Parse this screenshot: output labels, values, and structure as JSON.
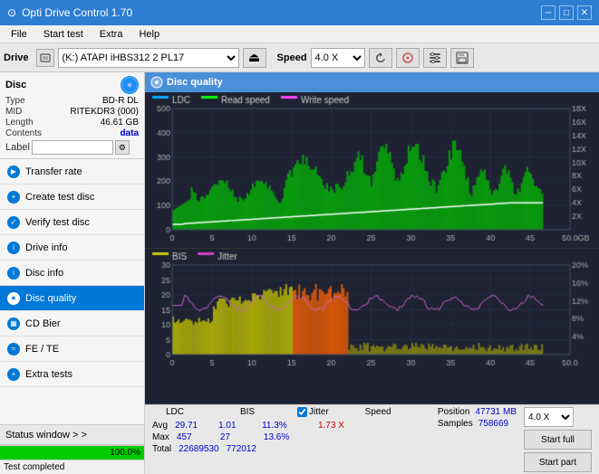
{
  "app": {
    "title": "Opti Drive Control 1.70",
    "icon": "⊙"
  },
  "titlebar": {
    "minimize": "─",
    "maximize": "□",
    "close": "✕"
  },
  "menu": {
    "items": [
      "File",
      "Start test",
      "Extra",
      "Help"
    ]
  },
  "drive_bar": {
    "label": "Drive",
    "drive_value": "(K:) ATAPI iHBS312  2 PL17",
    "speed_label": "Speed",
    "speed_value": "4.0 X"
  },
  "disc": {
    "title": "Disc",
    "type_label": "Type",
    "type_value": "BD-R DL",
    "mid_label": "MID",
    "mid_value": "RITEKDR3 (000)",
    "length_label": "Length",
    "length_value": "46.61 GB",
    "contents_label": "Contents",
    "contents_value": "data",
    "label_label": "Label",
    "label_value": ""
  },
  "nav": {
    "items": [
      {
        "id": "transfer-rate",
        "label": "Transfer rate",
        "active": false
      },
      {
        "id": "create-test-disc",
        "label": "Create test disc",
        "active": false
      },
      {
        "id": "verify-test-disc",
        "label": "Verify test disc",
        "active": false
      },
      {
        "id": "drive-info",
        "label": "Drive info",
        "active": false
      },
      {
        "id": "disc-info",
        "label": "Disc info",
        "active": false
      },
      {
        "id": "disc-quality",
        "label": "Disc quality",
        "active": true
      },
      {
        "id": "cd-bier",
        "label": "CD Bier",
        "active": false
      },
      {
        "id": "fe-te",
        "label": "FE / TE",
        "active": false
      },
      {
        "id": "extra-tests",
        "label": "Extra tests",
        "active": false
      }
    ]
  },
  "disc_quality": {
    "title": "Disc quality",
    "legend_ldc": "LDC",
    "legend_read": "Read speed",
    "legend_write": "Write speed",
    "legend_bis": "BIS",
    "legend_jitter": "Jitter",
    "x_max": "50.0",
    "x_label": "GB"
  },
  "stats": {
    "headers": [
      "LDC",
      "BIS",
      "",
      "Jitter",
      "Speed",
      ""
    ],
    "avg_label": "Avg",
    "avg_ldc": "29.71",
    "avg_bis": "1.01",
    "avg_jitter": "11.3%",
    "max_label": "Max",
    "max_ldc": "457",
    "max_bis": "27",
    "max_jitter": "13.6%",
    "total_label": "Total",
    "total_ldc": "22689530",
    "total_bis": "772012",
    "speed_label": "Speed",
    "speed_value": "1.73 X",
    "position_label": "Position",
    "position_value": "47731 MB",
    "samples_label": "Samples",
    "samples_value": "758669",
    "speed_select": "4.0 X",
    "start_full": "Start full",
    "start_part": "Start part"
  },
  "status": {
    "window_btn": "Status window > >",
    "progress": 100.0,
    "progress_text": "100.0%",
    "status_text": "Test completed"
  },
  "colors": {
    "accent": "#0078d7",
    "bg_dark": "#1a1a2e",
    "bg_chart": "#2a2a3e",
    "grid": "#3a3a5e",
    "ldc": "#00cc00",
    "read_speed": "#ffffff",
    "write_speed": "#ff00ff",
    "bis_yellow": "#cccc00",
    "bis_orange": "#ff8800",
    "jitter": "#cc44cc",
    "progress_green": "#00cc00"
  }
}
